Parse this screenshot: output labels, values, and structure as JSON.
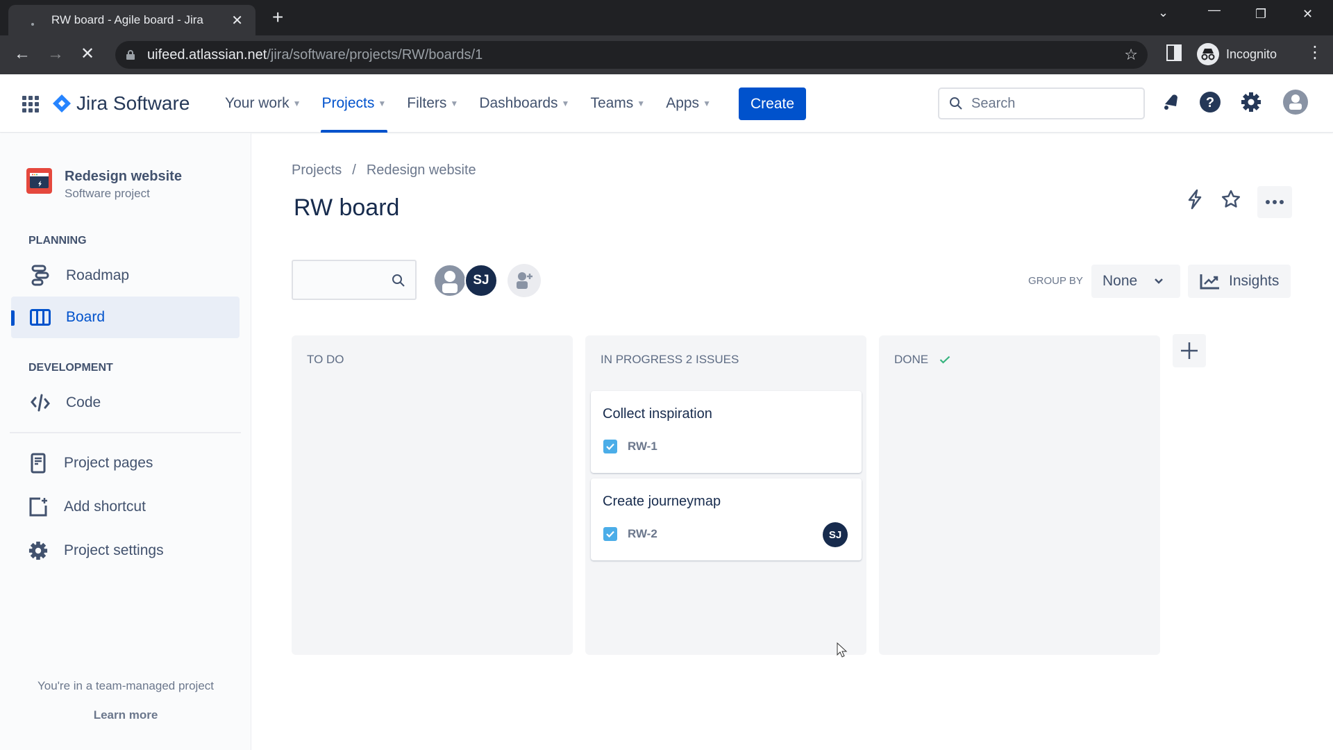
{
  "browser": {
    "tab_title": "RW board - Agile board - Jira",
    "url_host": "uifeed.atlassian.net",
    "url_path": "/jira/software/projects/RW/boards/1",
    "profile_label": "Incognito"
  },
  "topnav": {
    "product": "Jira Software",
    "items": [
      {
        "label": "Your work",
        "active": false
      },
      {
        "label": "Projects",
        "active": true
      },
      {
        "label": "Filters",
        "active": false
      },
      {
        "label": "Dashboards",
        "active": false
      },
      {
        "label": "Teams",
        "active": false
      },
      {
        "label": "Apps",
        "active": false
      }
    ],
    "create_label": "Create",
    "search_placeholder": "Search"
  },
  "sidebar": {
    "project_name": "Redesign website",
    "project_type": "Software project",
    "sections": {
      "planning": "PLANNING",
      "development": "DEVELOPMENT"
    },
    "items": [
      {
        "label": "Roadmap",
        "icon": "roadmap-icon"
      },
      {
        "label": "Board",
        "icon": "board-icon",
        "active": true
      },
      {
        "label": "Code",
        "icon": "code-icon"
      },
      {
        "label": "Project pages",
        "icon": "pages-icon"
      },
      {
        "label": "Add shortcut",
        "icon": "add-shortcut-icon"
      },
      {
        "label": "Project settings",
        "icon": "gear-icon"
      }
    ],
    "footer_text": "You're in a team-managed project",
    "footer_link": "Learn more"
  },
  "main": {
    "breadcrumb": [
      "Projects",
      "Redesign website"
    ],
    "breadcrumb_sep": "/",
    "title": "RW board",
    "avatars": [
      {
        "initials": ""
      },
      {
        "initials": "SJ"
      }
    ],
    "group_by_label": "GROUP BY",
    "group_by_value": "None",
    "insights_label": "Insights",
    "columns": [
      {
        "title": "TO DO",
        "cards": []
      },
      {
        "title": "IN PROGRESS 2 ISSUES",
        "cards": [
          {
            "title": "Collect inspiration",
            "key": "RW-1",
            "assignee": ""
          },
          {
            "title": "Create journeymap",
            "key": "RW-2",
            "assignee": "SJ"
          }
        ]
      },
      {
        "title": "DONE",
        "done_check": true,
        "cards": []
      }
    ]
  },
  "colors": {
    "brand": "#0052cc",
    "project_icon": "#e5483d",
    "task_icon": "#4bade8",
    "done_check": "#36b37e",
    "avatar_dark": "#172b4d"
  }
}
